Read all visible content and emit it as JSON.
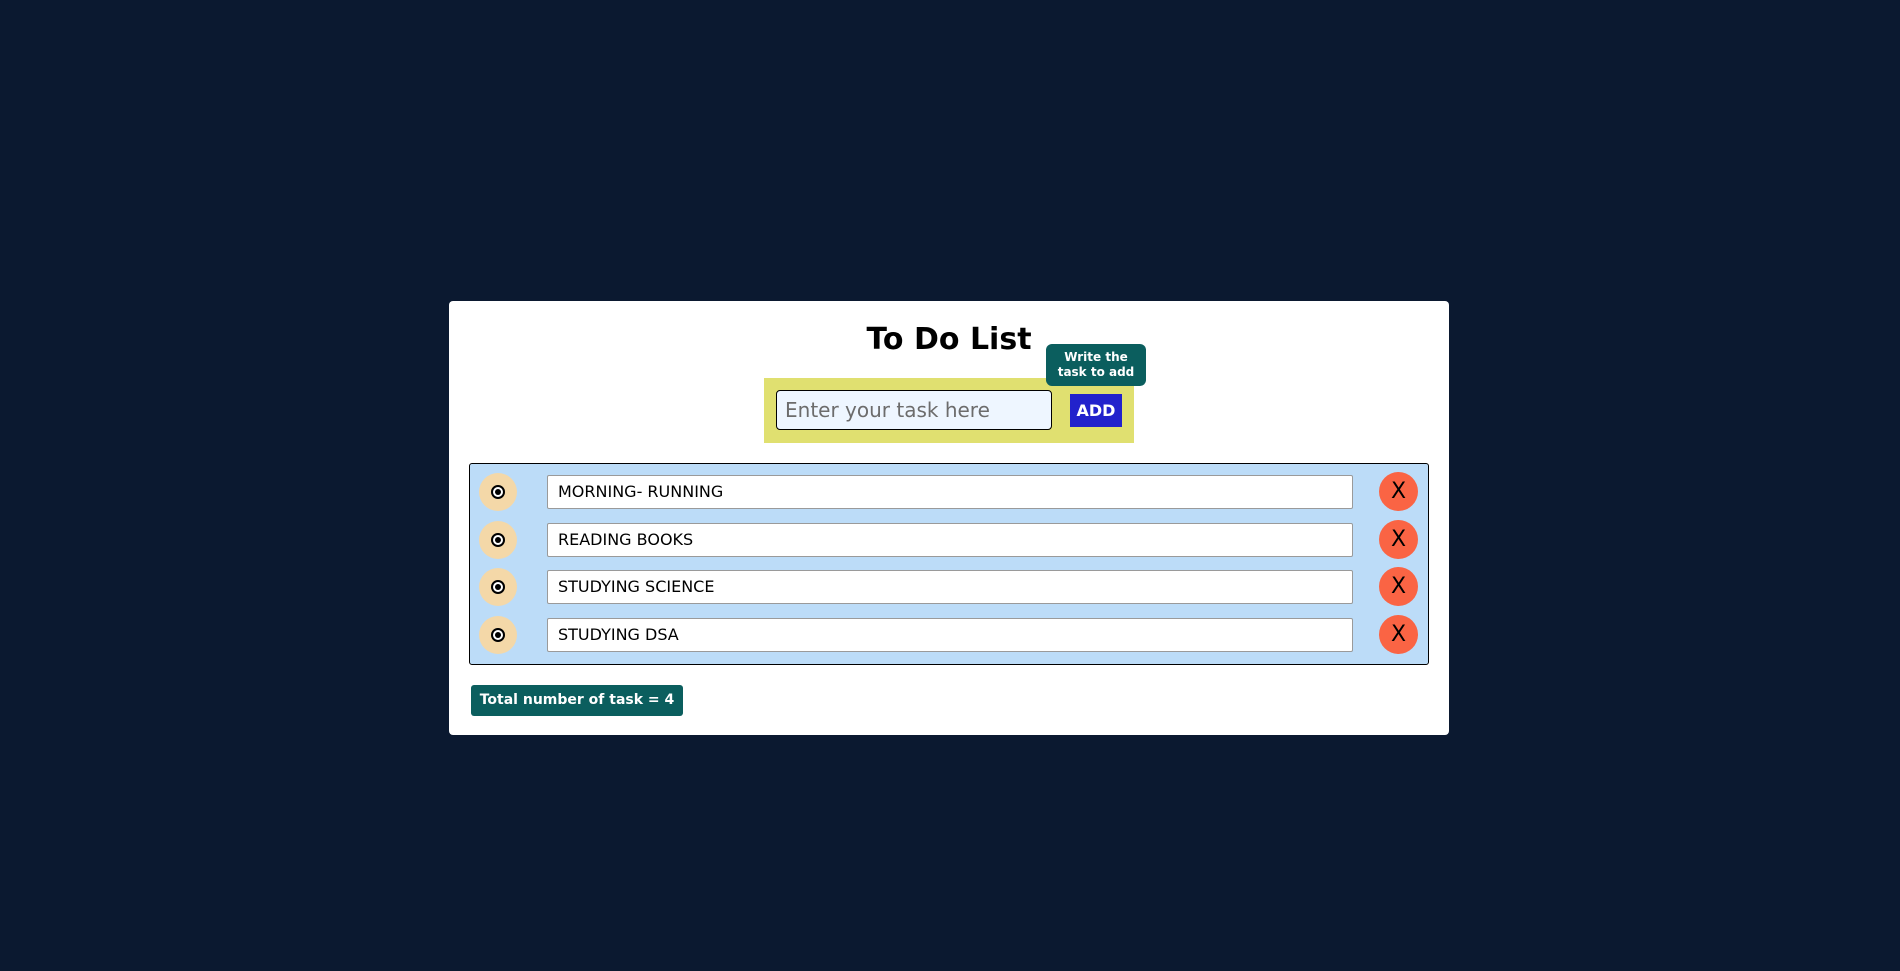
{
  "app": {
    "title": "To Do List"
  },
  "input": {
    "placeholder": "Enter your task here",
    "value": ""
  },
  "add_button": {
    "label": "ADD"
  },
  "tooltip": {
    "text": "Write the task to add"
  },
  "tasks": [
    {
      "text": "MORNING- RUNNING",
      "delete_label": "X"
    },
    {
      "text": "READING BOOKS",
      "delete_label": "X"
    },
    {
      "text": "STUDYING SCIENCE",
      "delete_label": "X"
    },
    {
      "text": "STUDYING DSA",
      "delete_label": "X"
    }
  ],
  "footer": {
    "total_label": "Total number of task = 4"
  },
  "colors": {
    "background": "#0b1930",
    "card": "#ffffff",
    "input_bar": "#e0e070",
    "add_button": "#2222cc",
    "tooltip": "#0b5e5e",
    "task_list_bg": "#bcdcf8",
    "check_circle": "#f4d8a8",
    "delete_button": "#fa6444",
    "total_badge": "#0b5e5e"
  },
  "icons": {
    "check": "radio-check-icon",
    "delete": "close-icon"
  }
}
